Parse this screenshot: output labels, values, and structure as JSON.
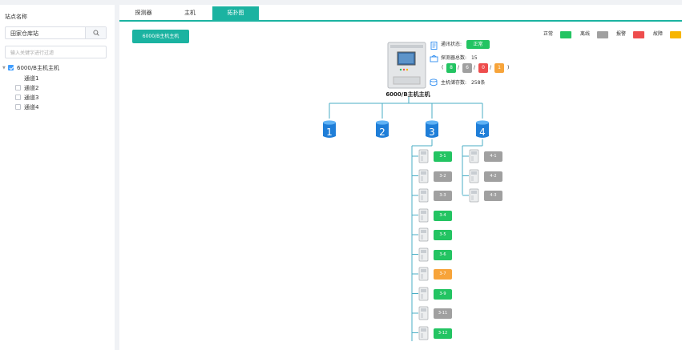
{
  "sidebar": {
    "title": "站点名称",
    "station_value": "田家仓库站",
    "filter_placeholder": "输入关键字进行过滤",
    "tree": {
      "root_label": "6000/B主机主机",
      "children": [
        "通道1",
        "通道2",
        "通道3",
        "通道4"
      ]
    }
  },
  "tabs": [
    "探测器",
    "主机",
    "拓扑图"
  ],
  "active_tab": "拓扑图",
  "host_button": "6000/B主机主机",
  "legend": [
    {
      "label": "正常",
      "color": "#23c462"
    },
    {
      "label": "离线",
      "color": "#a0a0a0"
    },
    {
      "label": "报警",
      "color": "#ee4d4d"
    },
    {
      "label": "故障",
      "color": "#f7b500"
    }
  ],
  "host": {
    "name": "6000/B主机主机",
    "comm_label": "通讯状态:",
    "comm_status": "正常",
    "detector_label": "探测器总数:",
    "detector_total": "15",
    "counts": [
      {
        "value": "8",
        "color": "#23c462"
      },
      {
        "value": "6",
        "color": "#a0a0a0"
      },
      {
        "value": "0",
        "color": "#ee4d4d"
      },
      {
        "value": "1",
        "color": "#f7a43a"
      }
    ],
    "memory_label": "主机储存数:",
    "memory_value": "258条"
  },
  "channels": [
    {
      "label": "1",
      "nodes": []
    },
    {
      "label": "2",
      "nodes": []
    },
    {
      "label": "3",
      "nodes": [
        {
          "label": "3-1",
          "color": "#23c462"
        },
        {
          "label": "3-2",
          "color": "#a0a0a0"
        },
        {
          "label": "3-3",
          "color": "#a0a0a0"
        },
        {
          "label": "3-4",
          "color": "#23c462"
        },
        {
          "label": "3-5",
          "color": "#23c462"
        },
        {
          "label": "3-6",
          "color": "#23c462"
        },
        {
          "label": "3-7",
          "color": "#f7a43a"
        },
        {
          "label": "3-9",
          "color": "#23c462"
        },
        {
          "label": "3-11",
          "color": "#a0a0a0"
        },
        {
          "label": "3-12",
          "color": "#23c462"
        }
      ]
    },
    {
      "label": "4",
      "nodes": [
        {
          "label": "4-1",
          "color": "#a0a0a0"
        },
        {
          "label": "4-2",
          "color": "#a0a0a0"
        },
        {
          "label": "4-3",
          "color": "#a0a0a0"
        }
      ]
    }
  ]
}
